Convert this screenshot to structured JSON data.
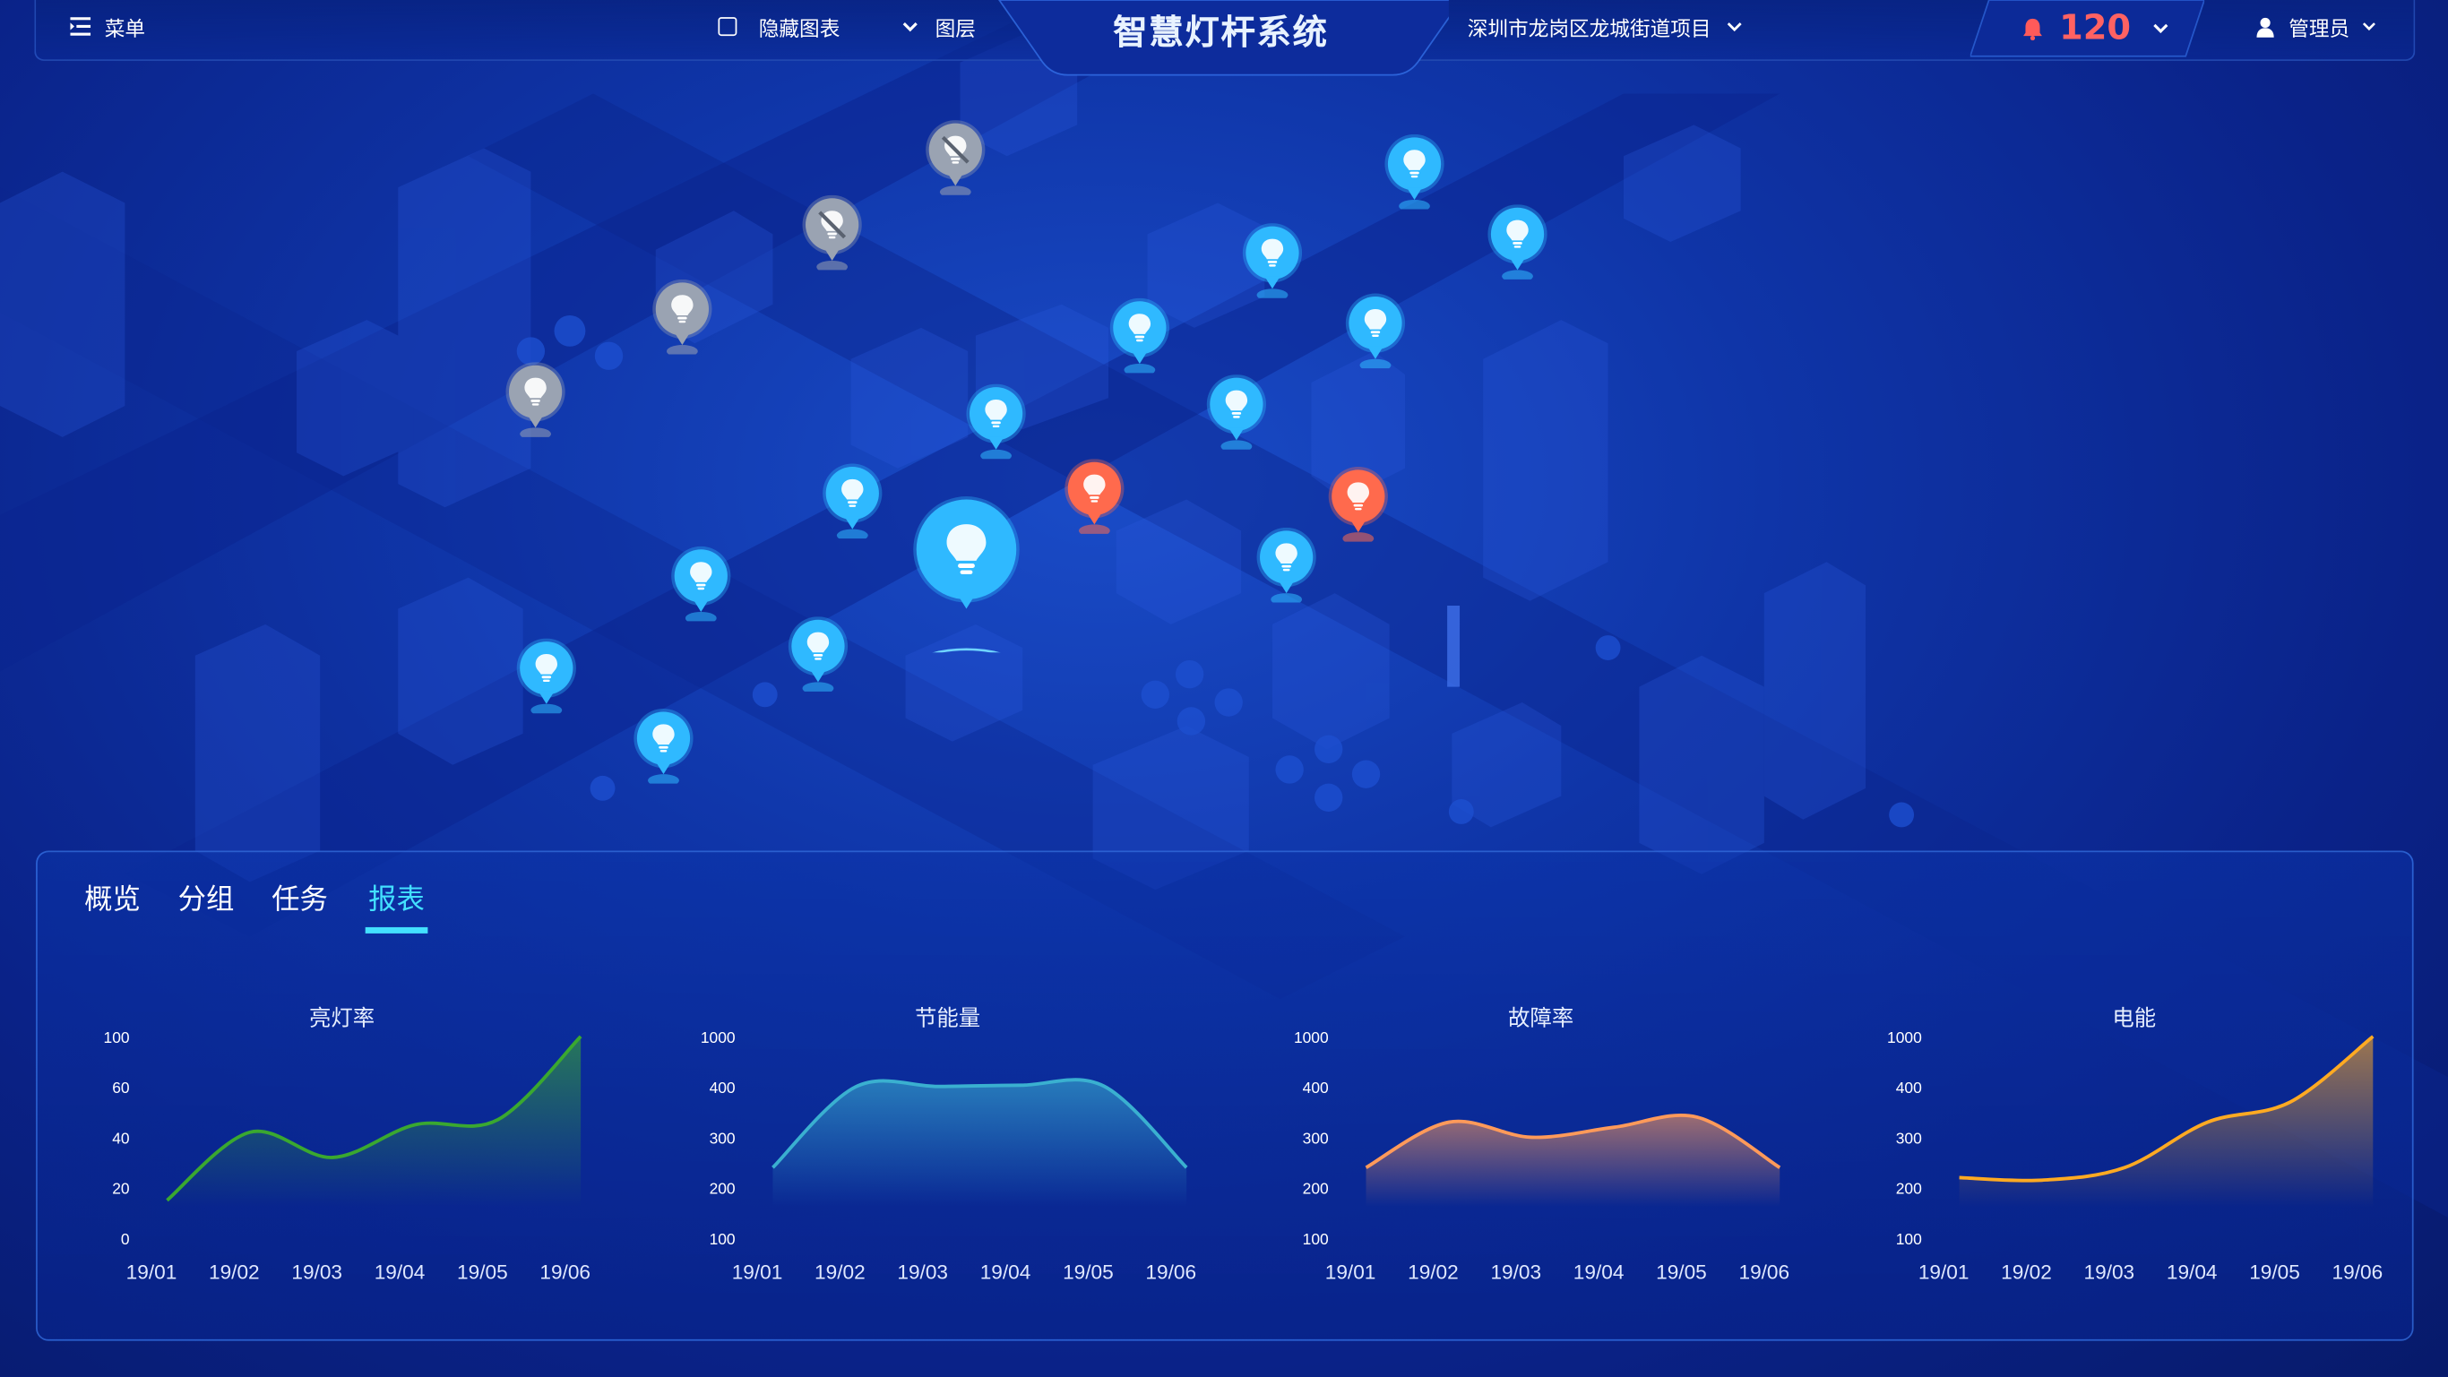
{
  "header": {
    "menu_label": "菜单",
    "hide_charts_label": "隐藏图表",
    "layers_label": "图层",
    "app_title": "智慧灯杆系统",
    "project_label": "深圳市龙岗区龙城街道项目",
    "alarm_count": "120",
    "user_label": "管理员"
  },
  "map": {
    "pins": [
      {
        "status": "offline-disabled"
      },
      {
        "status": "offline-disabled"
      },
      {
        "status": "offline"
      },
      {
        "status": "offline"
      },
      {
        "status": "online"
      },
      {
        "status": "online"
      },
      {
        "status": "online"
      },
      {
        "status": "online"
      },
      {
        "status": "online"
      },
      {
        "status": "online"
      },
      {
        "status": "online"
      },
      {
        "status": "online"
      },
      {
        "status": "online"
      },
      {
        "status": "online"
      },
      {
        "status": "online"
      },
      {
        "status": "online"
      },
      {
        "status": "online"
      },
      {
        "status": "fault"
      },
      {
        "status": "fault"
      },
      {
        "status": "selected"
      }
    ],
    "colors": {
      "online": "#2fb9ff",
      "offline": "#9aa3b2",
      "fault": "#ff6a4d"
    }
  },
  "panel": {
    "tabs": [
      {
        "label": "概览",
        "active": false
      },
      {
        "label": "分组",
        "active": false
      },
      {
        "label": "任务",
        "active": false
      },
      {
        "label": "报表",
        "active": true
      }
    ]
  },
  "chart_data": [
    {
      "type": "area",
      "title": "亮灯率",
      "categories": [
        "19/01",
        "19/02",
        "19/03",
        "19/04",
        "19/05",
        "19/06"
      ],
      "y_ticks": [
        "0",
        "20",
        "40",
        "60",
        "100"
      ],
      "series": [
        {
          "values": [
            15,
            42,
            32,
            45,
            47,
            100
          ]
        }
      ],
      "color": "#3aa830"
    },
    {
      "type": "area",
      "title": "节能量",
      "categories": [
        "19/01",
        "19/02",
        "19/03",
        "19/04",
        "19/05",
        "19/06"
      ],
      "y_ticks": [
        "100",
        "200",
        "300",
        "400",
        "1000"
      ],
      "series": [
        {
          "values": [
            240,
            400,
            405,
            420,
            410,
            240
          ]
        }
      ],
      "color": "#3ab0d0"
    },
    {
      "type": "area",
      "title": "故障率",
      "categories": [
        "19/01",
        "19/02",
        "19/03",
        "19/04",
        "19/05",
        "19/06"
      ],
      "y_ticks": [
        "100",
        "200",
        "300",
        "400",
        "1000"
      ],
      "series": [
        {
          "values": [
            240,
            330,
            300,
            320,
            340,
            240
          ]
        }
      ],
      "color": "#ff9a5a"
    },
    {
      "type": "area",
      "title": "电能",
      "categories": [
        "19/01",
        "19/02",
        "19/03",
        "19/04",
        "19/05",
        "19/06"
      ],
      "y_ticks": [
        "100",
        "200",
        "300",
        "400",
        "1000"
      ],
      "series": [
        {
          "values": [
            220,
            215,
            240,
            330,
            370,
            1000
          ]
        }
      ],
      "color": "#ffaa22"
    }
  ]
}
